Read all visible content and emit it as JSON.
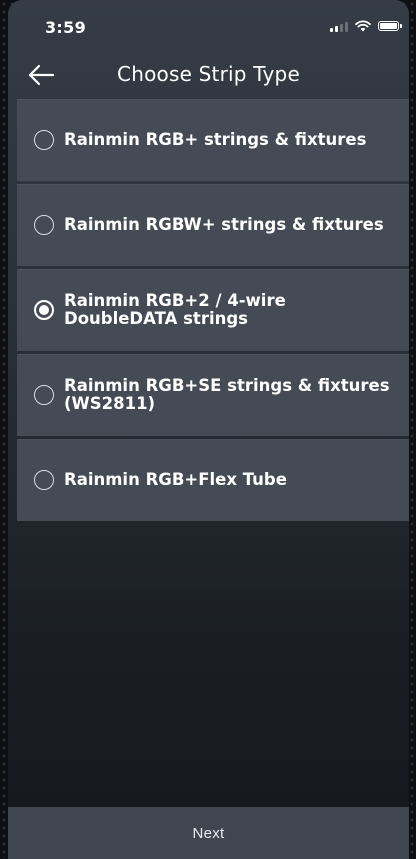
{
  "status_bar": {
    "time": "3:59"
  },
  "header": {
    "title": "Choose Strip Type",
    "back_icon": "arrow-left-icon"
  },
  "options": [
    {
      "lines": [
        "Rainmin RGB+ strings & fixtures"
      ],
      "selected": false
    },
    {
      "lines": [
        "Rainmin RGBW+ strings & fixtures"
      ],
      "selected": false
    },
    {
      "lines": [
        "Rainmin RGB+2 / 4-wire",
        "DoubleDATA strings"
      ],
      "selected": true
    },
    {
      "lines": [
        "Rainmin RGB+SE strings & fixtures",
        "(WS2811)"
      ],
      "selected": false
    },
    {
      "lines": [
        "Rainmin RGB+Flex Tube"
      ],
      "selected": false
    }
  ],
  "footer": {
    "next_label": "Next"
  },
  "colors": {
    "card": "#444b55",
    "footer": "#3f4650",
    "text": "#ffffff"
  }
}
